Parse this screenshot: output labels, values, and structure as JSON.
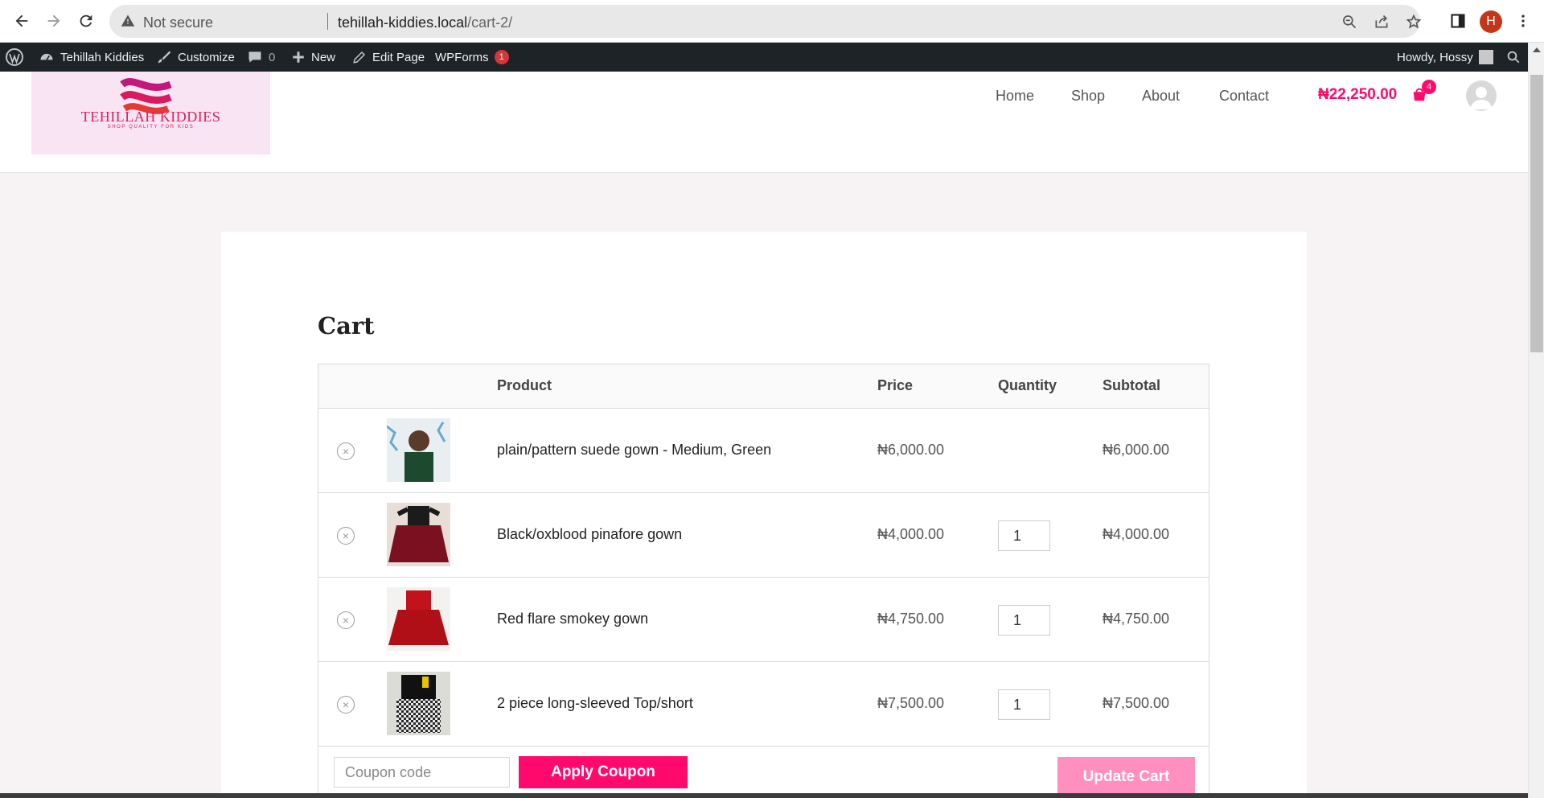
{
  "browser": {
    "not_secure_label": "Not secure",
    "url_host": "tehillah-kiddies.local",
    "url_path": "/cart-2/",
    "profile_initial": "H"
  },
  "admin_bar": {
    "site_name": "Tehillah Kiddies",
    "customize": "Customize",
    "comments_count": "0",
    "new": "New",
    "edit_page": "Edit Page",
    "wpforms": "WPForms",
    "wpforms_badge": "1",
    "howdy": "Howdy, Hossy"
  },
  "site": {
    "logo_title": "TEHILLAH KIDDIES",
    "logo_tagline": "SHOP QUALITY FOR KIDS",
    "nav": {
      "home": "Home",
      "shop": "Shop",
      "about": "About",
      "contact": "Contact"
    },
    "cart_total": "₦22,250.00",
    "cart_count": "4",
    "accent_color": "#ff0a6c"
  },
  "cart": {
    "heading": "Cart",
    "columns": {
      "product": "Product",
      "price": "Price",
      "quantity": "Quantity",
      "subtotal": "Subtotal"
    },
    "rows": [
      {
        "name": "plain/pattern suede gown - Medium, Green",
        "price": "₦6,000.00",
        "quantity": "",
        "subtotal": "₦6,000.00",
        "remove": "×"
      },
      {
        "name": "Black/oxblood pinafore gown",
        "price": "₦4,000.00",
        "quantity": "1",
        "subtotal": "₦4,000.00",
        "remove": "×"
      },
      {
        "name": "Red flare smokey gown",
        "price": "₦4,750.00",
        "quantity": "1",
        "subtotal": "₦4,750.00",
        "remove": "×"
      },
      {
        "name": "2 piece long-sleeved Top/short",
        "price": "₦7,500.00",
        "quantity": "1",
        "subtotal": "₦7,500.00",
        "remove": "×"
      }
    ],
    "coupon_placeholder": "Coupon code",
    "apply_coupon": "Apply Coupon",
    "update_cart": "Update Cart"
  }
}
